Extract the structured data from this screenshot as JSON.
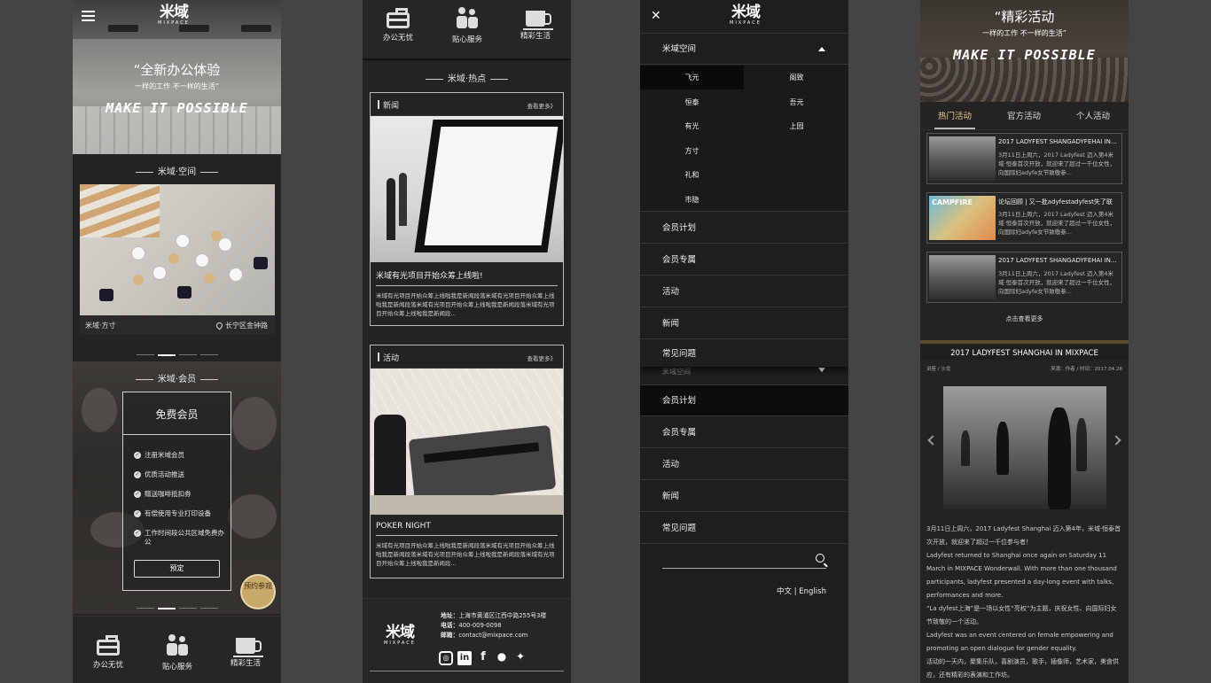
{
  "panel1": {
    "logo_main": "米域",
    "logo_sub": "MIXPACE",
    "hero_title": "“全新办公体验",
    "hero_sub": "一样的工作 不一样的生活”",
    "hero_script": "MAKE IT POSSIBLE",
    "space_section": "米域·空间",
    "space_name": "米域·方寸",
    "space_location": "长宁区金钟路",
    "member_section": "米域·会员",
    "member_card_title": "免费会员",
    "benefits": [
      "注册米域会员",
      "优质活动推送",
      "赠送咖啡抵扣券",
      "有偿使用专业打印设备",
      "工作时间段公共区域免费办公"
    ],
    "reserve_button": "预定",
    "book_visit": "预约参观",
    "nav": [
      "办公无忧",
      "贴心服务",
      "精彩生活"
    ]
  },
  "panel2": {
    "nav": [
      "办公无忧",
      "贴心服务",
      "精彩生活"
    ],
    "hot_section": "米域·热点",
    "news": {
      "header": "新闻",
      "more": "查看更多》",
      "title": "米域有光项目开始众筹上线啦!",
      "text": "米域有光项目开始众筹上线啦我是新闻段落米域有光项目开始众筹上线啦我是新闻段落米域有光项目开始众筹上线啦我是新闻段落米域有光项目开始众筹上线啦我是新闻段..."
    },
    "activity": {
      "header": "活动",
      "more": "查看更多》",
      "title": "POKER NIGHT",
      "text": "米域有光项目开始众筹上线啦我是新闻段落米域有光项目开始众筹上线啦我是新闻段落米域有光项目开始众筹上线啦我是新闻段落米域有光项目开始众筹上线啦我是新闻段..."
    },
    "footer": {
      "logo_main": "米域",
      "logo_sub": "MIXPACE",
      "address_label": "地址：",
      "address": "上海市黄浦区江西中路255号3楼",
      "phone_label": "电话：",
      "phone": "400-009-0098",
      "email_label": "邮箱：",
      "email": "contact@mixpace.com"
    }
  },
  "panel3": {
    "logo_main": "米域",
    "logo_sub": "MIXPACE",
    "space_menu": "米域空间",
    "spaces": [
      "飞元",
      "阁致",
      "恒泰",
      "吾元",
      "有光",
      "上园",
      "方寸",
      "礼和",
      "市隐"
    ],
    "menu": [
      "会员计划",
      "会员专属",
      "活动",
      "新闻",
      "常见问题"
    ],
    "space_menu_overlap": "米域空间",
    "menu2": [
      "会员计划",
      "会员专属",
      "活动",
      "新闻",
      "常见问题"
    ],
    "lang_zh": "中文",
    "lang_sep": "|",
    "lang_en": "English"
  },
  "panel4": {
    "hero_title": "“精彩活动",
    "hero_sub": "一样的工作 不一样的生活”",
    "hero_script": "MAKE IT POSSIBLE",
    "tabs": [
      "热门活动",
      "官方活动",
      "个人活动"
    ],
    "activities": [
      {
        "title": "2017 LADYFEST SHANGADYFEHAI IN MIXPACE",
        "desc": "3月11日上周六，2017 Ladyfest 迈入第4米域·恒泰首次开放，就迎来了超过一千位女性，向国际妇adyfe女节致敬参..."
      },
      {
        "title": "论坛回顾 | 又一批adyfestadyfest失了联",
        "desc": "3月11日上周六，2017 Ladyfest 迈入第4米域·恒泰首次开放，就迎来了超过一千位女性，向国际妇adyfe女节致敬参..."
      },
      {
        "title": "2017 LADYFEST SHANGADYFEHAI IN MIXPACE",
        "desc": "3月11日上周六，2017 Ladyfest 迈入第4米域·恒泰首次开放，就迎来了超过一千位女性，向国际妇adyfe女节致敬参..."
      }
    ],
    "camp_text": "CAMPFIRE",
    "more": "点击查看更多",
    "article_title": "2017 LADYFEST SHANGHAI IN MIXPACE",
    "meta_left": "讲座 / 沙龙",
    "meta_right": "来源：作者 / 时间：2017.04.28",
    "body": [
      "3月11日上周六，2017 Ladyfest Shanghai 迈入第4年，米域·恒泰首次开放，就迎来了超过一千位参与者！",
      "Ladyfest returned to Shanghai once again on Saturday 11 March in MIXPACE Wonderwall. With more than one thousand participants, ladyfest presented a day-long event with talks, performances and more.",
      "“La dyfest上海”是一场以女性“亮权”为主题，庆祝女性、向国际妇女节致敬的一个活动。",
      "Ladyfest was an event centered on female empowering and promoting an open dialogue for gender equality.",
      "活动的一天内，聚集乐队，喜剧演员，歌手，插像师，艺术家，美食供应，还有精彩的表演和工作坊。"
    ]
  }
}
